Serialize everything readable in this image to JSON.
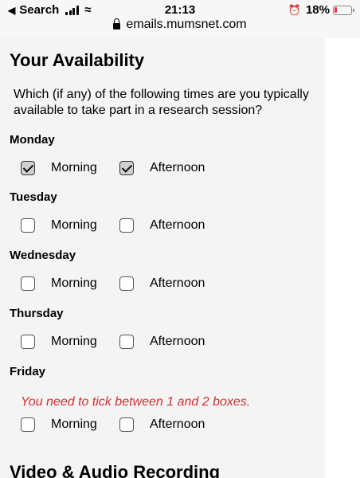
{
  "status_bar": {
    "back_label": "Search",
    "time": "21:13",
    "battery_percent": "18%",
    "battery_level": 0.18,
    "url": "emails.mumsnet.com"
  },
  "form": {
    "title": "Your Availability",
    "question": "Which (if any) of the following times are you typically available to take part in a research session?",
    "days": [
      {
        "name": "Monday",
        "options": [
          {
            "label": "Morning",
            "checked": true
          },
          {
            "label": "Afternoon",
            "checked": true
          }
        ]
      },
      {
        "name": "Tuesday",
        "options": [
          {
            "label": "Morning",
            "checked": false
          },
          {
            "label": "Afternoon",
            "checked": false
          }
        ]
      },
      {
        "name": "Wednesday",
        "options": [
          {
            "label": "Morning",
            "checked": false
          },
          {
            "label": "Afternoon",
            "checked": false
          }
        ]
      },
      {
        "name": "Thursday",
        "options": [
          {
            "label": "Morning",
            "checked": false
          },
          {
            "label": "Afternoon",
            "checked": false
          }
        ]
      },
      {
        "name": "Friday",
        "error": "You need to tick between 1 and 2 boxes.",
        "options": [
          {
            "label": "Morning",
            "checked": false
          },
          {
            "label": "Afternoon",
            "checked": false
          }
        ]
      }
    ],
    "next_section_title": "Video & Audio Recording"
  },
  "colors": {
    "error": "#d32f2f",
    "battery_low": "#e53935"
  }
}
